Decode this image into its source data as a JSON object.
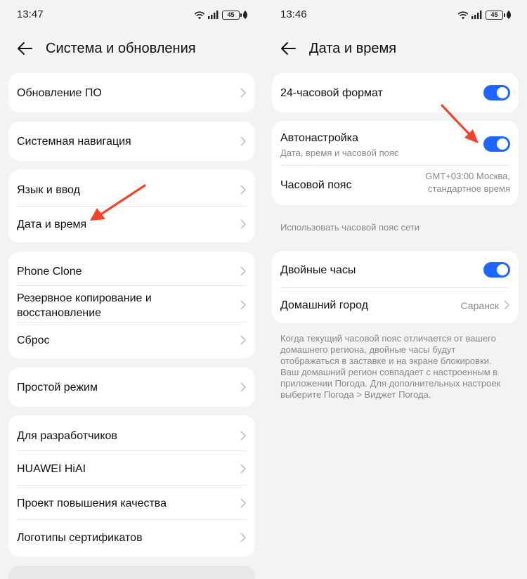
{
  "left": {
    "status": {
      "time": "13:47",
      "battery": "45"
    },
    "header": {
      "title": "Система и обновления"
    },
    "cards": [
      {
        "items": [
          "Обновление ПО"
        ]
      },
      {
        "items": [
          "Системная навигация"
        ]
      },
      {
        "items": [
          "Язык и ввод",
          "Дата и время"
        ]
      },
      {
        "items": [
          "Phone Clone",
          "Резервное копирование и восстановление",
          "Сброс"
        ]
      },
      {
        "items": [
          "Простой режим"
        ]
      },
      {
        "items": [
          "Для разработчиков",
          "HUAWEI HiAI",
          "Проект повышения качества",
          "Логотипы сертификатов"
        ]
      }
    ]
  },
  "right": {
    "status": {
      "time": "13:46",
      "battery": "45"
    },
    "header": {
      "title": "Дата и время"
    },
    "format24": {
      "label": "24-часовой формат",
      "enabled": true
    },
    "auto": {
      "label": "Автонастройка",
      "sub": "Дата, время и часовой пояс",
      "enabled": true
    },
    "timezone": {
      "label": "Часовой пояс",
      "value_line1": "GMT+03:00 Москва,",
      "value_line2": "стандартное время"
    },
    "network_tz_note": "Использовать часовой пояс сети",
    "dual_clock": {
      "label": "Двойные часы",
      "enabled": true
    },
    "home_city": {
      "label": "Домашний город",
      "value": "Саранск"
    },
    "dual_note": "Когда текущий часовой пояс отличается от вашего домашнего региона, двойные часы будут отображаться в заставке и на экране блокировки. Ваш домашний регион совпадает с настроенным в приложении Погода. Для дополнительных настроек выберите Погода > Виджет Погода."
  },
  "colors": {
    "accent": "#1f66ff",
    "arrow": "#f0442c",
    "background": "#f1f3f5"
  },
  "icons": [
    "back-arrow-icon",
    "chevron-right-icon",
    "wifi-icon",
    "signal-icon",
    "battery-icon",
    "leaf-icon"
  ]
}
